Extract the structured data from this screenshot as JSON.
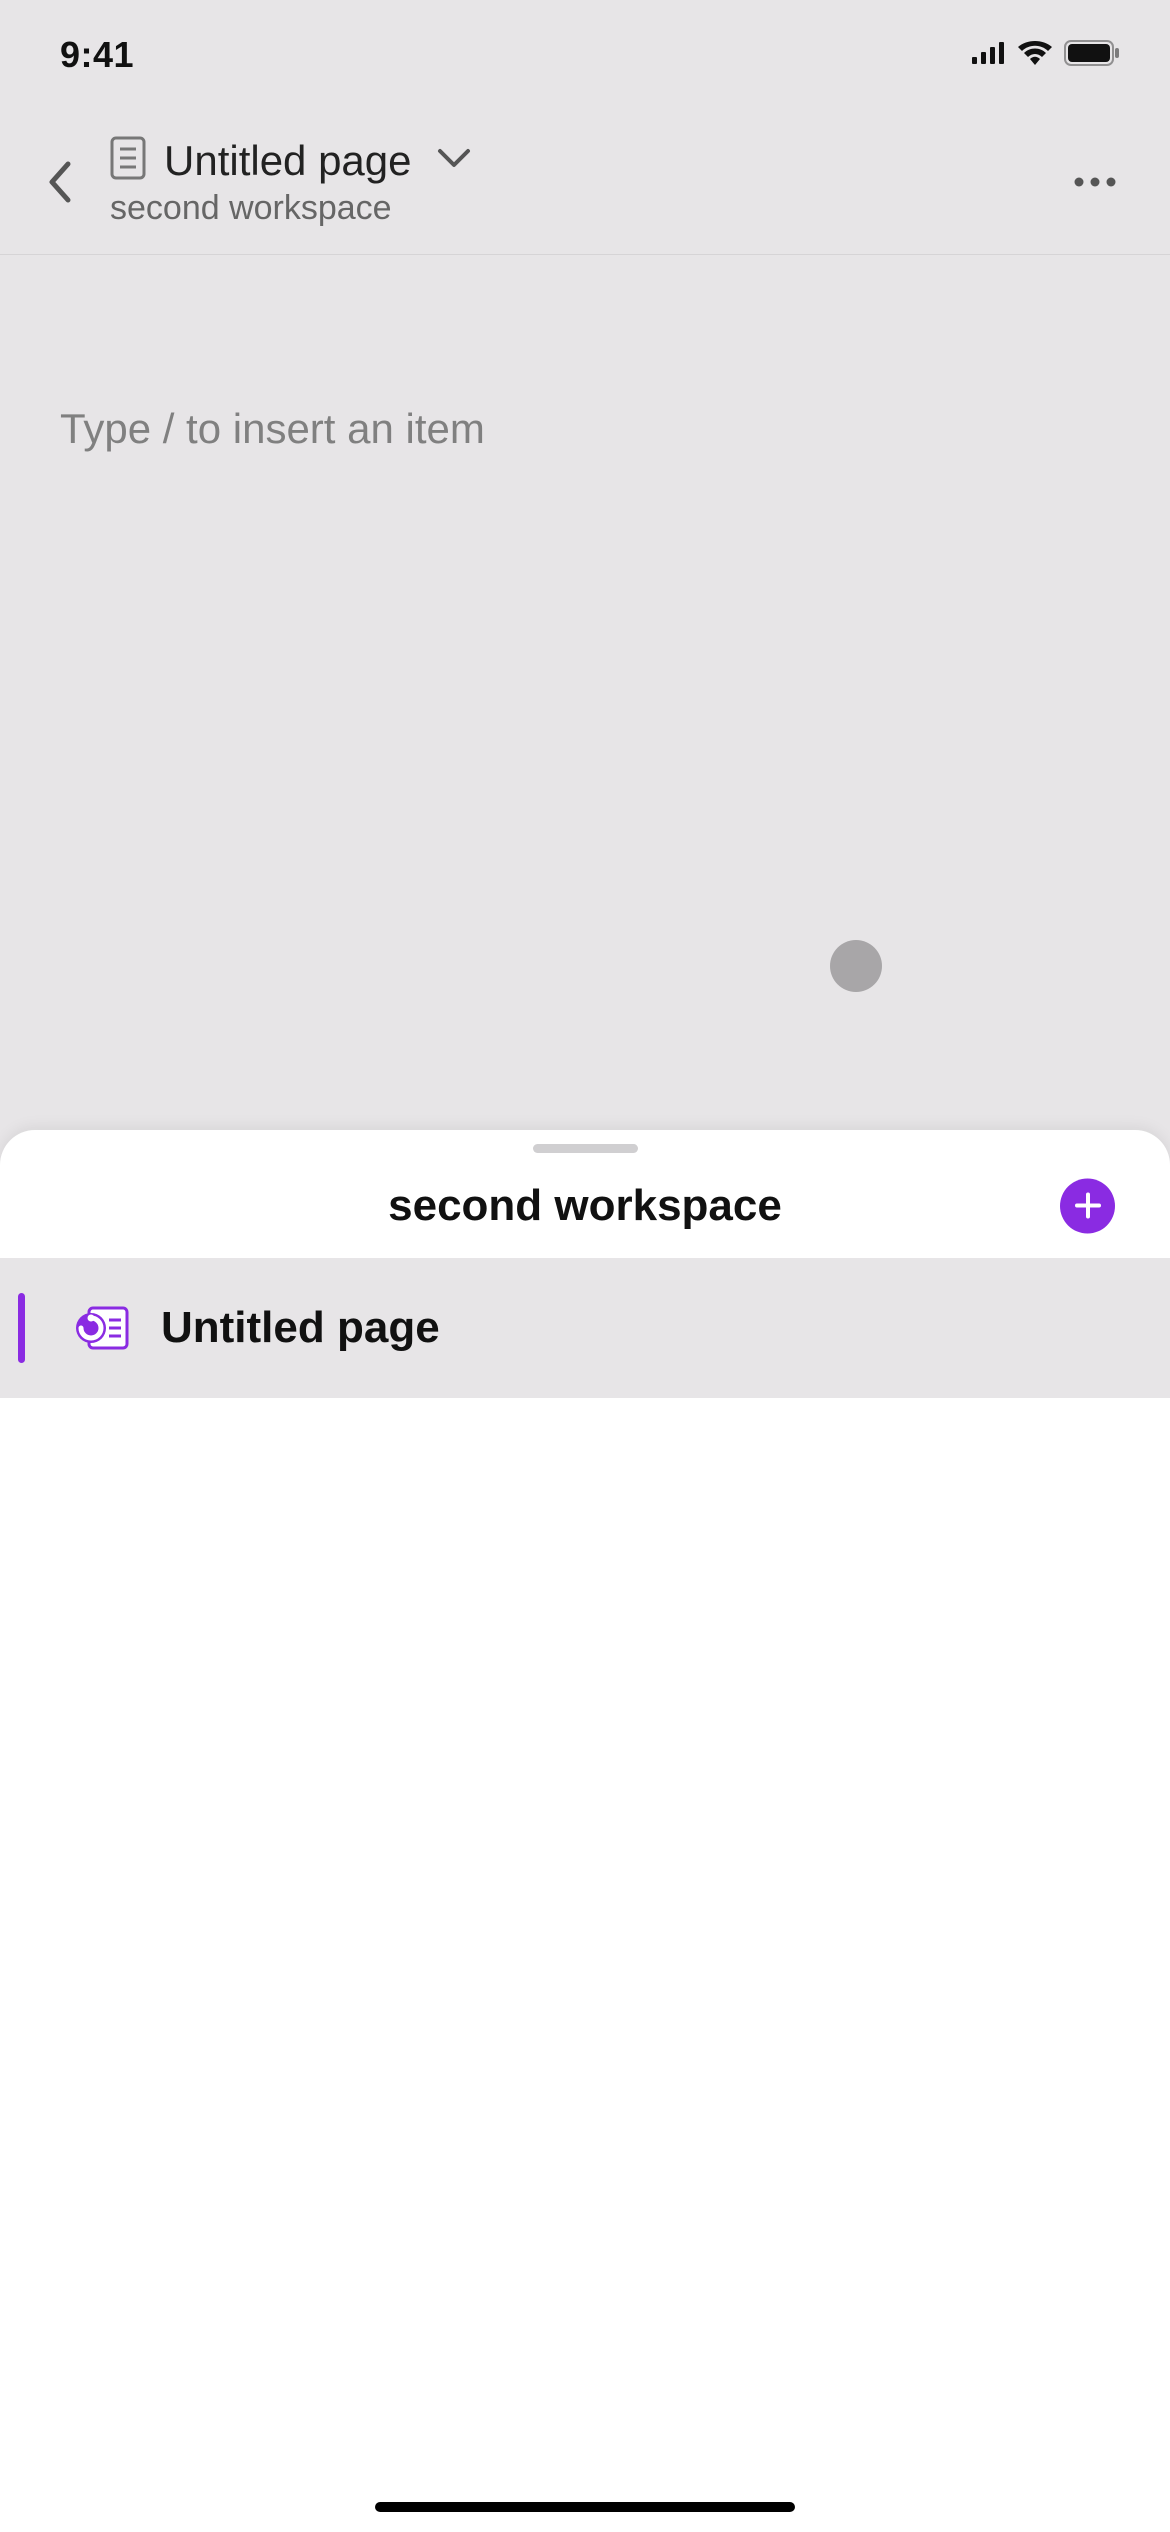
{
  "status": {
    "time": "9:41"
  },
  "header": {
    "page_title": "Untitled page",
    "workspace": "second workspace"
  },
  "editor": {
    "placeholder": "Type / to insert an item"
  },
  "sheet": {
    "title": "second workspace",
    "pages": [
      {
        "label": "Untitled page"
      }
    ]
  }
}
